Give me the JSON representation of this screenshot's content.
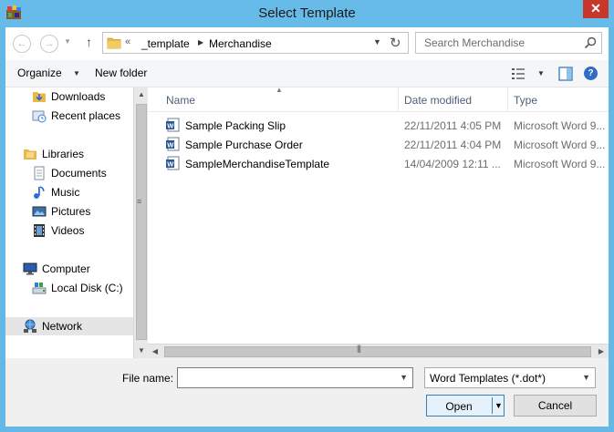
{
  "window": {
    "title": "Select Template",
    "close_glyph": "✕"
  },
  "address": {
    "overflow": "«",
    "crumbs": [
      "_template",
      "Merchandise"
    ]
  },
  "search": {
    "placeholder": "Search Merchandise"
  },
  "toolbar": {
    "organize": "Organize",
    "new_folder": "New folder"
  },
  "nav_pane": {
    "items": [
      {
        "label": "Downloads",
        "icon": "downloads-icon"
      },
      {
        "label": "Recent places",
        "icon": "recent-places-icon"
      },
      {
        "label": "Libraries",
        "icon": "libraries-icon"
      },
      {
        "label": "Documents",
        "icon": "documents-icon"
      },
      {
        "label": "Music",
        "icon": "music-icon"
      },
      {
        "label": "Pictures",
        "icon": "pictures-icon"
      },
      {
        "label": "Videos",
        "icon": "videos-icon"
      },
      {
        "label": "Computer",
        "icon": "computer-icon"
      },
      {
        "label": "Local Disk (C:)",
        "icon": "disk-icon"
      },
      {
        "label": "Network",
        "icon": "network-icon",
        "selected": true
      }
    ]
  },
  "file_list": {
    "columns": [
      "Name",
      "Date modified",
      "Type"
    ],
    "rows": [
      {
        "name": "Sample Packing Slip",
        "date": "22/11/2011 4:05 PM",
        "type": "Microsoft Word 9..."
      },
      {
        "name": "Sample Purchase Order",
        "date": "22/11/2011 4:04 PM",
        "type": "Microsoft Word 9..."
      },
      {
        "name": "SampleMerchandiseTemplate",
        "date": "14/04/2009 12:11 ...",
        "type": "Microsoft Word 9..."
      }
    ]
  },
  "bottom": {
    "file_name_label": "File name:",
    "file_name_value": "",
    "filter": "Word Templates (*.dot*)",
    "open": "Open",
    "cancel": "Cancel"
  },
  "colors": {
    "title_bar": "#67bbe8",
    "close_button": "#c7382c",
    "open_button_border": "#3c7fb1"
  }
}
